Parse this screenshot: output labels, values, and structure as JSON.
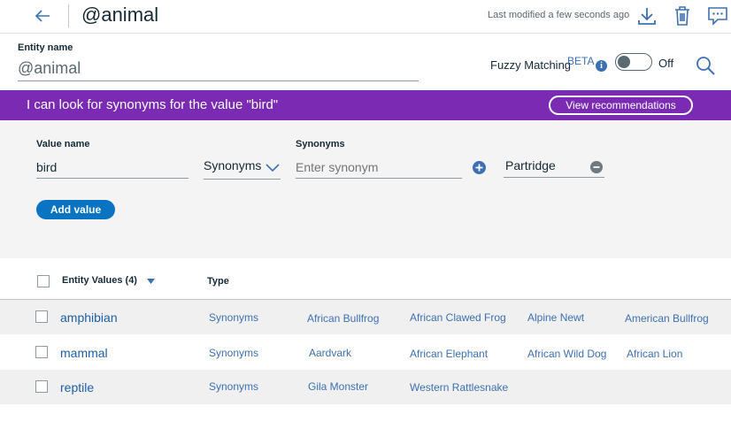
{
  "header": {
    "title": "@animal",
    "last_modified": "Last modified a few seconds ago"
  },
  "entity": {
    "label": "Entity name",
    "value": "@animal"
  },
  "fuzzy": {
    "label": "Fuzzy Matching",
    "badge": "BETA",
    "info_glyph": "i",
    "state": "Off"
  },
  "banner": {
    "text": "I can look for synonyms for the value \"bird\"",
    "button": "View recommendations",
    "color": "#7b2bb3"
  },
  "form": {
    "value_label": "Value name",
    "value": "bird",
    "type_selected": "Synonyms",
    "synonyms_label": "Synonyms",
    "synonym_placeholder": "Enter synonym",
    "synonym_chips": [
      "Partridge"
    ],
    "add_button": "Add value"
  },
  "table": {
    "header_values": "Entity Values (4)",
    "header_type": "Type",
    "rows": [
      {
        "name": "amphibian",
        "type": "Synonyms",
        "values": [
          "African Bullfrog",
          "African Clawed Frog",
          "Alpine Newt",
          "American Bullfrog"
        ]
      },
      {
        "name": "mammal",
        "type": "Synonyms",
        "values": [
          "Aardvark",
          "African Elephant",
          "African Wild Dog",
          "African Lion"
        ]
      },
      {
        "name": "reptile",
        "type": "Synonyms",
        "values": [
          "Gila Monster",
          "Western Rattlesnake"
        ]
      }
    ]
  },
  "icons": [
    "back-arrow-icon",
    "download-icon",
    "trash-icon",
    "chat-icon",
    "info-icon",
    "search-icon",
    "chevron-down-icon",
    "add-circle-icon",
    "remove-circle-icon",
    "sort-caret-icon"
  ],
  "colors": {
    "accent": "#3d70b2",
    "primary_button": "#0a74c2",
    "link": "#1d5fa6"
  }
}
